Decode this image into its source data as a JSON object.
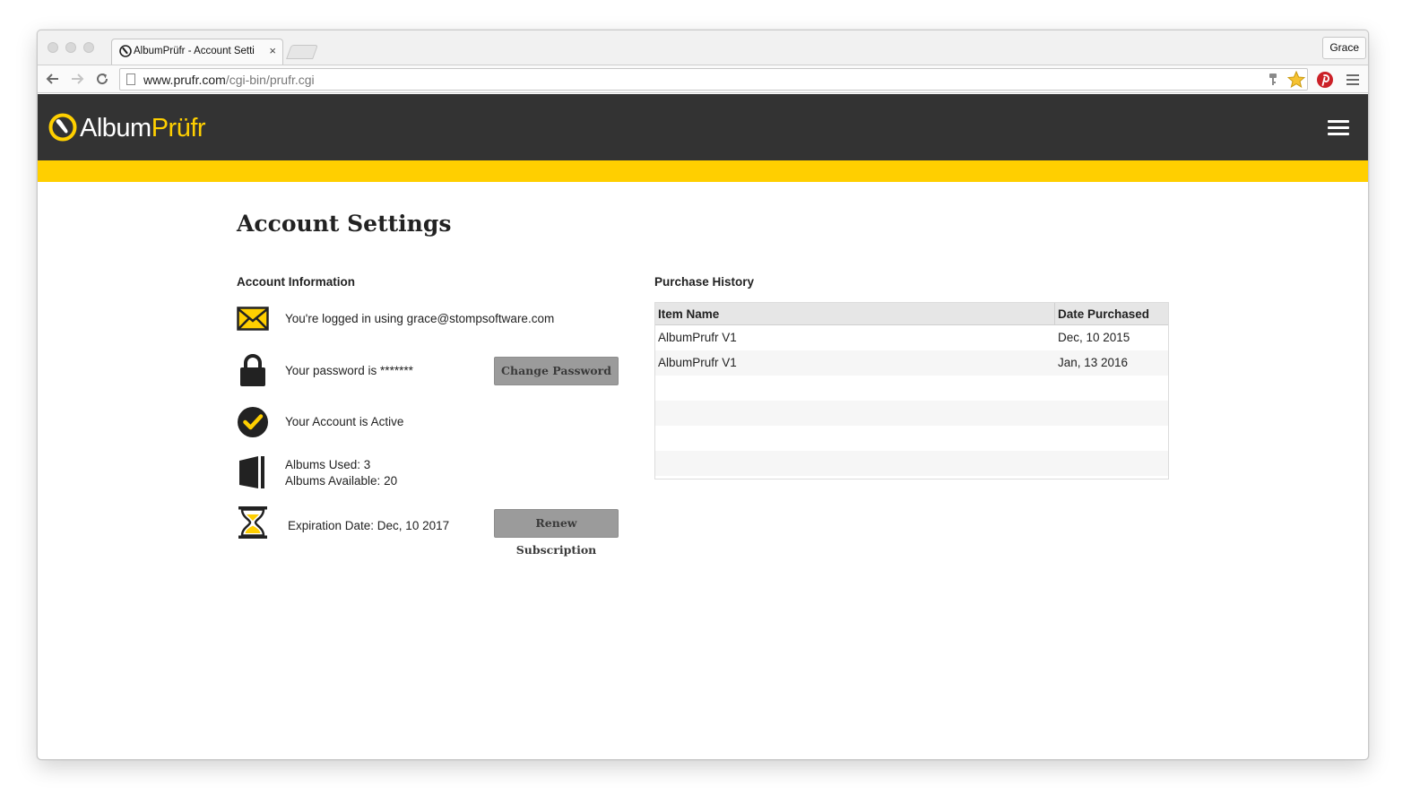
{
  "browser": {
    "tab_title": "AlbumPrüfr - Account Setti",
    "tab_close": "×",
    "profile": "Grace",
    "url_host": "www.prufr.com",
    "url_path": "/cgi-bin/prufr.cgi"
  },
  "site": {
    "logo_primary": "Album",
    "logo_accent": "Prüfr",
    "brand_color": "#ffcf00",
    "header_color": "#333333"
  },
  "page": {
    "title": "Account Settings"
  },
  "account": {
    "section_title": "Account Information",
    "email_text": "You're logged in using grace@stompsoftware.com",
    "password_text": "Your password is *******",
    "change_password_label": "Change Password",
    "status_text": "Your Account is Active",
    "albums_used": "Albums Used: 3",
    "albums_available": "Albums Available: 20",
    "expiration_text": "Expiration Date: Dec, 10 2017",
    "renew_label": "Renew Subscription",
    "icons": [
      "envelope-icon",
      "lock-icon",
      "check-circle-icon",
      "album-icon",
      "hourglass-icon"
    ]
  },
  "purchase_history": {
    "section_title": "Purchase History",
    "columns": [
      "Item Name",
      "Date Purchased"
    ],
    "rows": [
      {
        "item": "AlbumPrufr V1",
        "date": "Dec, 10 2015"
      },
      {
        "item": "AlbumPrufr V1",
        "date": "Jan, 13 2016"
      }
    ]
  }
}
